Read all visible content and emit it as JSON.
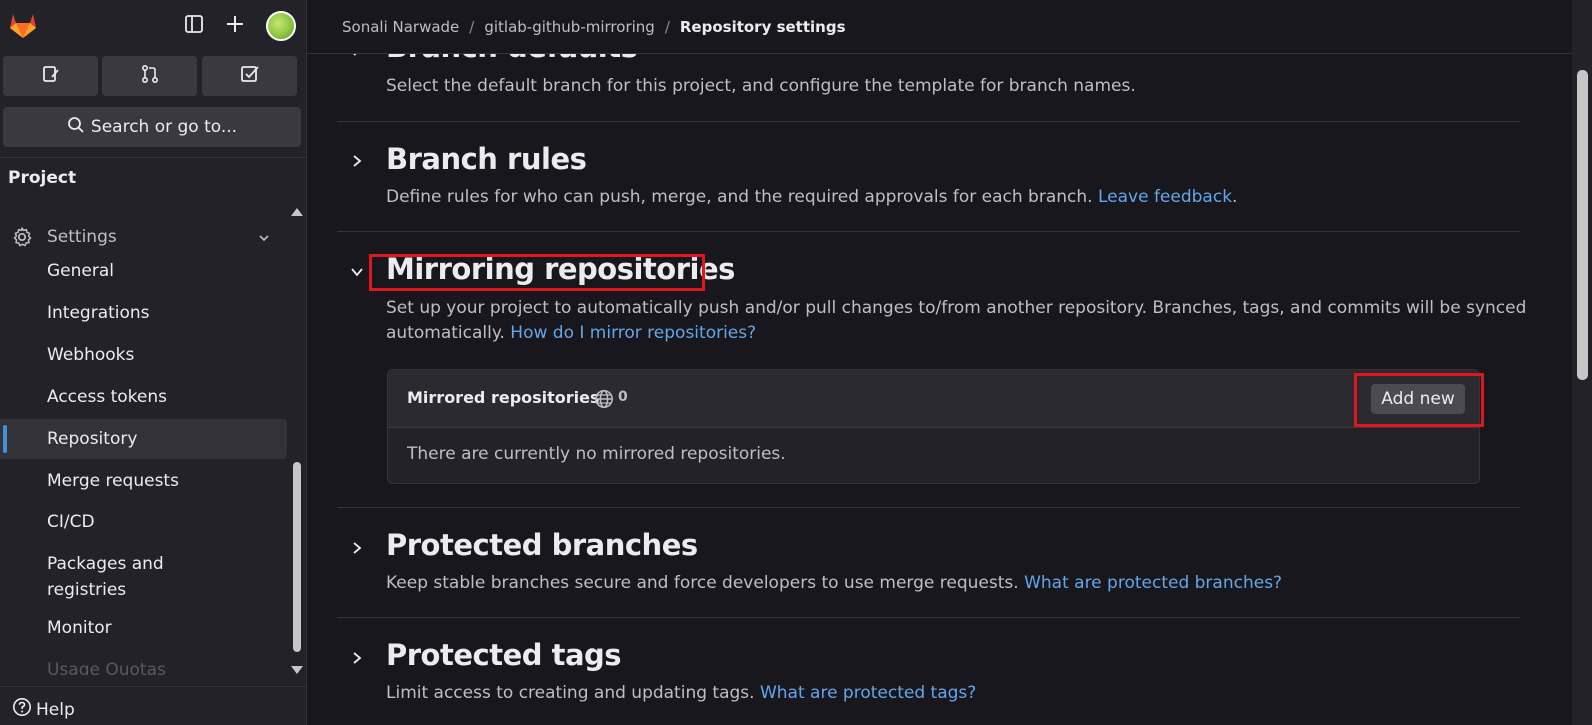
{
  "topbar": {
    "logo_icon": "gitlab-tanuki-icon",
    "sidebar_toggle_icon": "sidebar-toggle-icon",
    "create_icon": "plus-icon",
    "avatar_icon": "user-avatar"
  },
  "quick_actions": [
    {
      "name": "issues",
      "icon": "issues-icon"
    },
    {
      "name": "merge-requests",
      "icon": "merge-request-icon"
    },
    {
      "name": "todos",
      "icon": "todo-checkbox-icon"
    }
  ],
  "search": {
    "label": "Search or go to..."
  },
  "sidebar": {
    "section_title": "Project",
    "settings_label": "Settings",
    "items": [
      {
        "label": "General"
      },
      {
        "label": "Integrations"
      },
      {
        "label": "Webhooks"
      },
      {
        "label": "Access tokens"
      },
      {
        "label": "Repository"
      },
      {
        "label": "Merge requests"
      },
      {
        "label": "CI/CD"
      },
      {
        "label": "Packages and registries"
      },
      {
        "label": "Monitor"
      },
      {
        "label": "Usage Quotas"
      }
    ],
    "help_label": "Help"
  },
  "breadcrumb": {
    "owner": "Sonali Narwade",
    "project": "gitlab-github-mirroring",
    "current": "Repository settings"
  },
  "sections": {
    "branch_defaults": {
      "title": "Branch defaults",
      "description": "Select the default branch for this project, and configure the template for branch names."
    },
    "branch_rules": {
      "title": "Branch rules",
      "description": "Define rules for who can push, merge, and the required approvals for each branch.",
      "link": "Leave feedback",
      "suffix": "."
    },
    "mirroring": {
      "title": "Mirroring repositories",
      "description_line1": "Set up your project to automatically push and/or pull changes to/from another repository. Branches, tags, and commits will be synced",
      "description_line2": "automatically.",
      "link": "How do I mirror repositories?",
      "card": {
        "title": "Mirrored repositories",
        "count": "0",
        "add_button": "Add new",
        "empty_text": "There are currently no mirrored repositories."
      }
    },
    "protected_branches": {
      "title": "Protected branches",
      "description": "Keep stable branches secure and force developers to use merge requests.",
      "link": "What are protected branches?"
    },
    "protected_tags": {
      "title": "Protected tags",
      "description": "Limit access to creating and updating tags.",
      "link": "What are protected tags?"
    }
  },
  "colors": {
    "background": "#18171d",
    "sidebar": "#232229",
    "link": "#63a6e9",
    "highlight": "#e0161f",
    "active_indicator": "#428fdc"
  }
}
